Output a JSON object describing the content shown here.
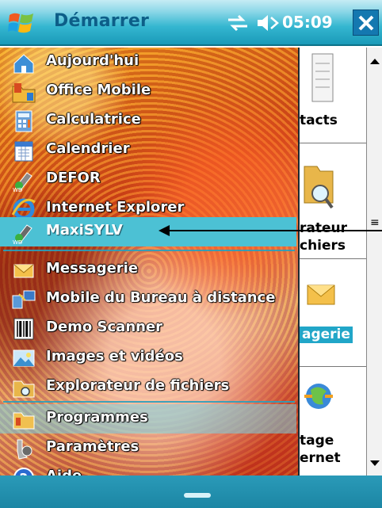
{
  "titlebar": {
    "title": "Démarrer",
    "time": "05:09",
    "icons": [
      "windows-logo-icon",
      "connectivity-icon",
      "speaker-icon",
      "close-icon"
    ]
  },
  "background_app": {
    "labels": [
      "tacts",
      "rateur",
      "chiers",
      "agerie",
      "tage",
      "ernet"
    ],
    "selected_label": "agerie"
  },
  "menu": {
    "items": [
      {
        "label": "Aujourd'hui",
        "icon": "today-icon"
      },
      {
        "label": "Office Mobile",
        "icon": "office-mobile-icon"
      },
      {
        "label": "Calculatrice",
        "icon": "calculator-icon"
      },
      {
        "label": "Calendrier",
        "icon": "calendar-icon"
      },
      {
        "label": "DEFOR",
        "icon": "defor-app-icon"
      },
      {
        "label": "Internet Explorer",
        "icon": "internet-explorer-icon"
      },
      {
        "label": "MaxiSYLV",
        "icon": "maxisylv-app-icon",
        "highlighted": true
      },
      {
        "label": "Messagerie",
        "icon": "messaging-icon"
      },
      {
        "label": "Mobile du Bureau à distance",
        "icon": "remote-desktop-icon"
      },
      {
        "label": "Demo Scanner",
        "icon": "barcode-scanner-icon"
      },
      {
        "label": "Images et vidéos",
        "icon": "pictures-icon"
      },
      {
        "label": "Explorateur de fichiers",
        "icon": "file-explorer-icon"
      },
      {
        "label": "Programmes",
        "icon": "programs-folder-icon"
      },
      {
        "label": "Paramètres",
        "icon": "settings-icon"
      },
      {
        "label": "Aide",
        "icon": "help-icon"
      }
    ]
  },
  "colors": {
    "titlebar": "#34b6d0",
    "highlight": "#4cc1d4",
    "selected_label_bg": "#21a6c8",
    "menu_text": "#ffffff"
  }
}
